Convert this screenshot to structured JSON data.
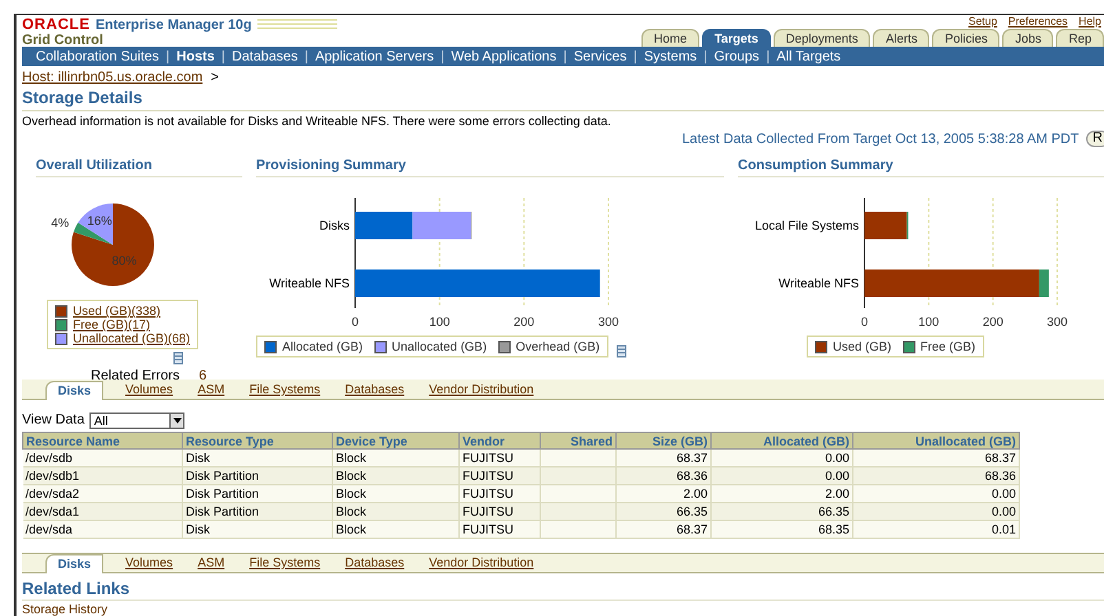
{
  "header": {
    "brand": "ORACLE",
    "product": "Enterprise Manager 10g",
    "subtitle": "Grid Control",
    "global_links": [
      "Setup",
      "Preferences",
      "Help"
    ],
    "tabs": [
      {
        "label": "Home",
        "selected": false
      },
      {
        "label": "Targets",
        "selected": true
      },
      {
        "label": "Deployments",
        "selected": false
      },
      {
        "label": "Alerts",
        "selected": false
      },
      {
        "label": "Policies",
        "selected": false
      },
      {
        "label": "Jobs",
        "selected": false
      },
      {
        "label": "Rep",
        "selected": false
      }
    ]
  },
  "nav_separator": "|",
  "nav": [
    {
      "label": "Collaboration Suites",
      "selected": false
    },
    {
      "label": "Hosts",
      "selected": true
    },
    {
      "label": "Databases",
      "selected": false
    },
    {
      "label": "Application Servers",
      "selected": false
    },
    {
      "label": "Web Applications",
      "selected": false
    },
    {
      "label": "Services",
      "selected": false
    },
    {
      "label": "Systems",
      "selected": false
    },
    {
      "label": "Groups",
      "selected": false
    },
    {
      "label": "All Targets",
      "selected": false
    }
  ],
  "breadcrumb": {
    "link": "Host: illinrbn05.us.oracle.com",
    "separator": ">"
  },
  "page_title": "Storage Details",
  "message": "Overhead information is not available for Disks and Writeable NFS. There were some errors collecting data.",
  "latest_data": "Latest Data Collected From Target Oct 13, 2005 5:38:28 AM PDT",
  "refresh_button": "R",
  "overall_utilization": {
    "title": "Overall Utilization",
    "chart_data": {
      "type": "pie",
      "categories": [
        "Used (GB)(338)",
        "Free (GB)(17)",
        "Unallocated (GB)(68)"
      ],
      "values": [
        80,
        4,
        16
      ],
      "colors": [
        "#993300",
        "#339966",
        "#9999ff"
      ],
      "value_labels": [
        "80%",
        "4%",
        "16%"
      ]
    },
    "related_errors": {
      "label": "Related Errors",
      "count": "6"
    }
  },
  "provisioning_summary": {
    "title": "Provisioning Summary",
    "chart_data": {
      "type": "bar",
      "orientation": "horizontal",
      "stacked": true,
      "categories": [
        "Disks",
        "Writeable NFS"
      ],
      "xlim": [
        0,
        300
      ],
      "xticks": [
        0,
        100,
        200,
        300
      ],
      "series": [
        {
          "name": "Allocated (GB)",
          "color": "#0066cc",
          "values": [
            68,
            290
          ]
        },
        {
          "name": "Unallocated (GB)",
          "color": "#9999ff",
          "values": [
            69,
            0
          ]
        },
        {
          "name": "Overhead (GB)",
          "color": "#999999",
          "values": [
            1,
            0
          ]
        }
      ]
    }
  },
  "consumption_summary": {
    "title": "Consumption Summary",
    "chart_data": {
      "type": "bar",
      "orientation": "horizontal",
      "stacked": true,
      "categories": [
        "Local File Systems",
        "Writeable NFS"
      ],
      "xlim": [
        0,
        300
      ],
      "xticks": [
        0,
        100,
        200,
        300
      ],
      "series": [
        {
          "name": "Used (GB)",
          "color": "#993300",
          "values": [
            66,
            272
          ]
        },
        {
          "name": "Free (GB)",
          "color": "#339966",
          "values": [
            2,
            15
          ]
        }
      ]
    }
  },
  "sub_tabs_top": [
    {
      "label": "Disks",
      "selected": true
    },
    {
      "label": "Volumes",
      "selected": false
    },
    {
      "label": "ASM",
      "selected": false
    },
    {
      "label": "File Systems",
      "selected": false
    },
    {
      "label": "Databases",
      "selected": false
    },
    {
      "label": "Vendor Distribution",
      "selected": false
    }
  ],
  "view_data": {
    "label": "View Data",
    "value": "All"
  },
  "table": {
    "columns": [
      "Resource Name",
      "Resource Type",
      "Device Type",
      "Vendor",
      "Shared",
      "Size (GB)",
      "Allocated (GB)",
      "Unallocated (GB)"
    ],
    "rows": [
      [
        "/dev/sdb",
        "Disk",
        "Block",
        "FUJITSU",
        "",
        "68.37",
        "0.00",
        "68.37"
      ],
      [
        "/dev/sdb1",
        "Disk Partition",
        "Block",
        "FUJITSU",
        "",
        "68.36",
        "0.00",
        "68.36"
      ],
      [
        "/dev/sda2",
        "Disk Partition",
        "Block",
        "FUJITSU",
        "",
        "2.00",
        "2.00",
        "0.00"
      ],
      [
        "/dev/sda1",
        "Disk Partition",
        "Block",
        "FUJITSU",
        "",
        "66.35",
        "66.35",
        "0.00"
      ],
      [
        "/dev/sda",
        "Disk",
        "Block",
        "FUJITSU",
        "",
        "68.37",
        "68.35",
        "0.01"
      ]
    ]
  },
  "sub_tabs_bottom": [
    {
      "label": "Disks",
      "selected": true
    },
    {
      "label": "Volumes",
      "selected": false
    },
    {
      "label": "ASM",
      "selected": false
    },
    {
      "label": "File Systems",
      "selected": false
    },
    {
      "label": "Databases",
      "selected": false
    },
    {
      "label": "Vendor Distribution",
      "selected": false
    }
  ],
  "related_links": {
    "title": "Related Links",
    "items": [
      "Storage History"
    ]
  }
}
